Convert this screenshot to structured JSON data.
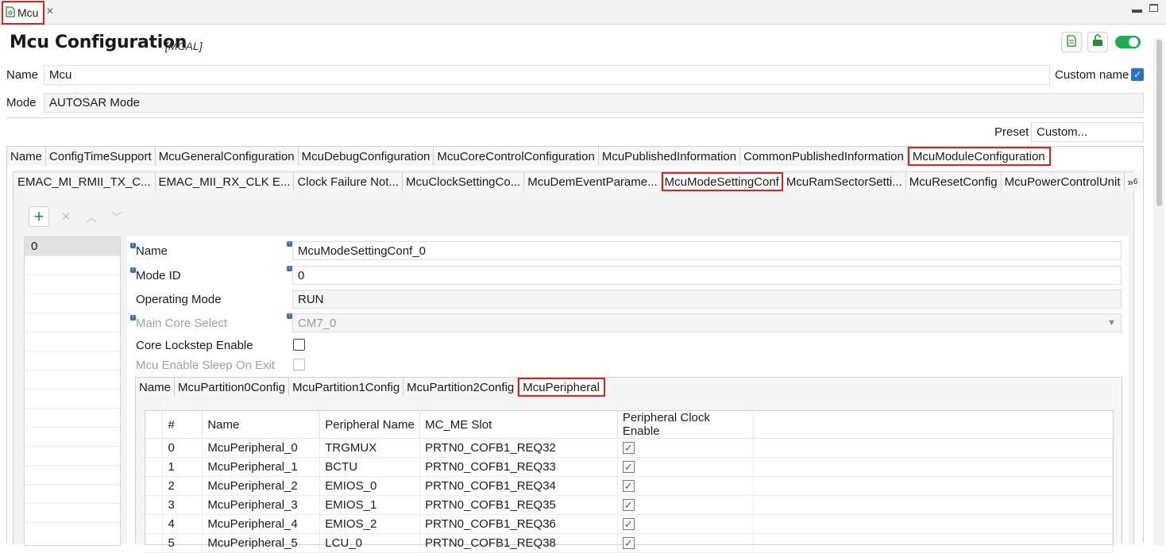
{
  "editor_tab": {
    "label": "Mcu"
  },
  "header": {
    "title": "Mcu Configuration",
    "subtitle": "[MCAL]"
  },
  "fields": {
    "name_label": "Name",
    "name_value": "Mcu",
    "custom_name_label": "Custom name",
    "custom_name_checked": true,
    "mode_label": "Mode",
    "mode_value": "AUTOSAR Mode",
    "preset_label": "Preset",
    "preset_value": "Custom..."
  },
  "main_tabs": [
    "Name",
    "ConfigTimeSupport",
    "McuGeneralConfiguration",
    "McuDebugConfiguration",
    "McuCoreControlConfiguration",
    "McuPublishedInformation",
    "CommonPublishedInformation",
    "McuModuleConfiguration"
  ],
  "sub_tabs": [
    "EMAC_MI_RMII_TX_C...",
    "EMAC_MII_RX_CLK E...",
    "Clock Failure Not...",
    "McuClockSettingCo...",
    "McuDemEventParame...",
    "McuModeSettingConf",
    "McuRamSectorSetti...",
    "McuResetConfig",
    "McuPowerControlUnit"
  ],
  "sub_tabs_overflow": {
    "chevron": "»",
    "count": "6"
  },
  "index_list": [
    "0"
  ],
  "form": {
    "name_label": "Name",
    "name_value": "McuModeSettingConf_0",
    "mode_id_label": "Mode ID",
    "mode_id_value": "0",
    "operating_mode_label": "Operating Mode",
    "operating_mode_value": "RUN",
    "main_core_label": "Main Core Select",
    "main_core_value": "CM7_0",
    "core_lockstep_label": "Core Lockstep Enable",
    "sleep_on_exit_label": "Mcu Enable Sleep On Exit"
  },
  "inner_tabs": [
    "Name",
    "McuPartition0Config",
    "McuPartition1Config",
    "McuPartition2Config",
    "McuPeripheral"
  ],
  "table": {
    "headers": [
      "#",
      "Name",
      "Peripheral Name",
      "MC_ME Slot",
      "Peripheral Clock Enable"
    ],
    "rows": [
      [
        "0",
        "McuPeripheral_0",
        "TRGMUX",
        "PRTN0_COFB1_REQ32"
      ],
      [
        "1",
        "McuPeripheral_1",
        "BCTU",
        "PRTN0_COFB1_REQ33"
      ],
      [
        "2",
        "McuPeripheral_2",
        "EMIOS_0",
        "PRTN0_COFB1_REQ34"
      ],
      [
        "3",
        "McuPeripheral_3",
        "EMIOS_1",
        "PRTN0_COFB1_REQ35"
      ],
      [
        "4",
        "McuPeripheral_4",
        "EMIOS_2",
        "PRTN0_COFB1_REQ36"
      ],
      [
        "5",
        "McuPeripheral_5",
        "LCU_0",
        "PRTN0_COFB1_REQ38"
      ]
    ]
  },
  "colors": {
    "highlight": "#e02020",
    "toggle_on": "#1fae4c",
    "checkbox_blue": "#2a72c8"
  }
}
